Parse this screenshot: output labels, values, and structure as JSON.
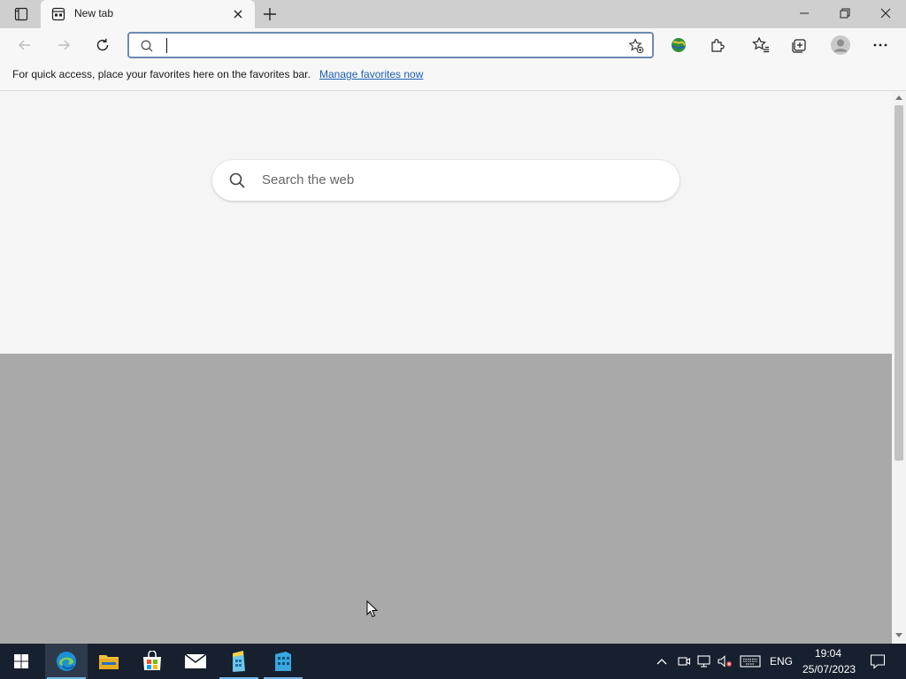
{
  "browser": {
    "tab": {
      "title": "New tab"
    },
    "address_bar": {
      "value": "",
      "placeholder": ""
    }
  },
  "favorites_bar": {
    "message": "For quick access, place your favorites here on the favorites bar.",
    "link": "Manage favorites now"
  },
  "page": {
    "search_placeholder": "Search the web",
    "lower_background_color": "#a9a9a9"
  },
  "taskbar": {
    "apps": [
      {
        "name": "start-icon"
      },
      {
        "name": "edge-icon",
        "active": true
      },
      {
        "name": "file-explorer-icon"
      },
      {
        "name": "microsoft-store-icon"
      },
      {
        "name": "mail-icon"
      },
      {
        "name": "app-building-icon"
      },
      {
        "name": "app-building-alt-icon"
      }
    ],
    "language": "ENG",
    "time": "19:04",
    "date": "25/07/2023",
    "accent_color": "#76b9ed"
  },
  "colors": {
    "address_border": "#6b8ab0",
    "link": "#1b5fb5",
    "taskbar_bg": "#16202e"
  }
}
